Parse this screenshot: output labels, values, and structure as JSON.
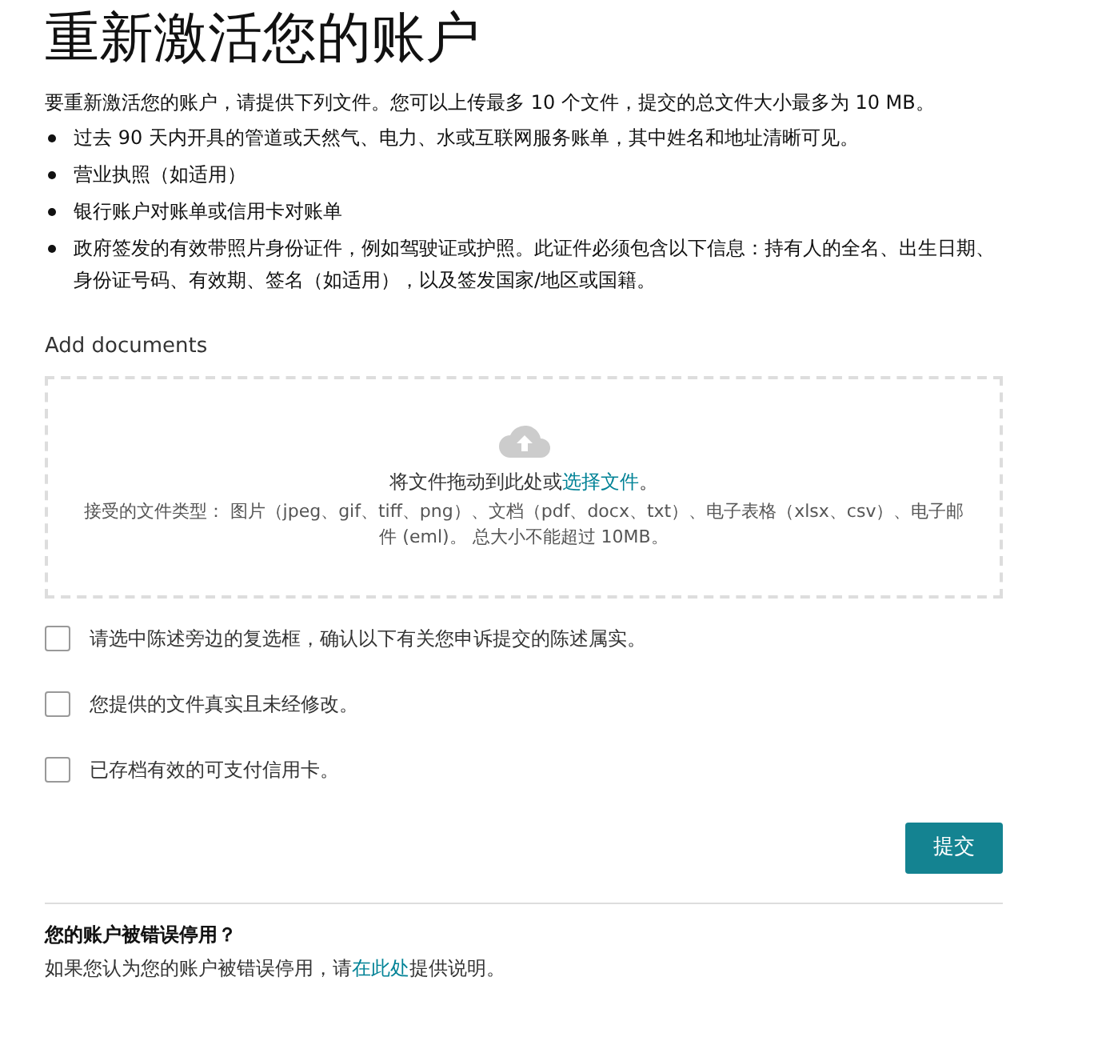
{
  "title": "重新激活您的账户",
  "intro": "要重新激活您的账户，请提供下列文件。您可以上传最多 10 个文件，提交的总文件大小最多为 10 MB。",
  "documents": [
    "过去 90 天内开具的管道或天然气、电力、水或互联网服务账单，其中姓名和地址清晰可见。",
    "营业执照（如适用）",
    "银行账户对账单或信用卡对账单",
    "政府签发的有效带照片身份证件，例如驾驶证或护照。此证件必须包含以下信息：持有人的全名、出生日期、身份证号码、有效期、签名（如适用），以及签发国家/地区或国籍。"
  ],
  "upload": {
    "label": "Add documents",
    "drop_text": "将文件拖动到此处或",
    "drop_link": "选择文件",
    "drop_end": "。",
    "accepted": "接受的文件类型： 图片（jpeg、gif、tiff、png）、文档（pdf、docx、txt）、电子表格（xlsx、csv）、电子邮件 (eml)。 总大小不能超过 10MB。"
  },
  "checkboxes": [
    {
      "label": "请选中陈述旁边的复选框，确认以下有关您申诉提交的陈述属实。",
      "checked": false
    },
    {
      "label": "您提供的文件真实且未经修改。",
      "checked": false
    },
    {
      "label": "已存档有效的可支付信用卡。",
      "checked": false
    }
  ],
  "submit": "提交",
  "footer": {
    "heading": "您的账户被错误停用？",
    "text_before": "如果您认为您的账户被错误停用，请",
    "link": "在此处",
    "text_after": "提供说明。"
  }
}
